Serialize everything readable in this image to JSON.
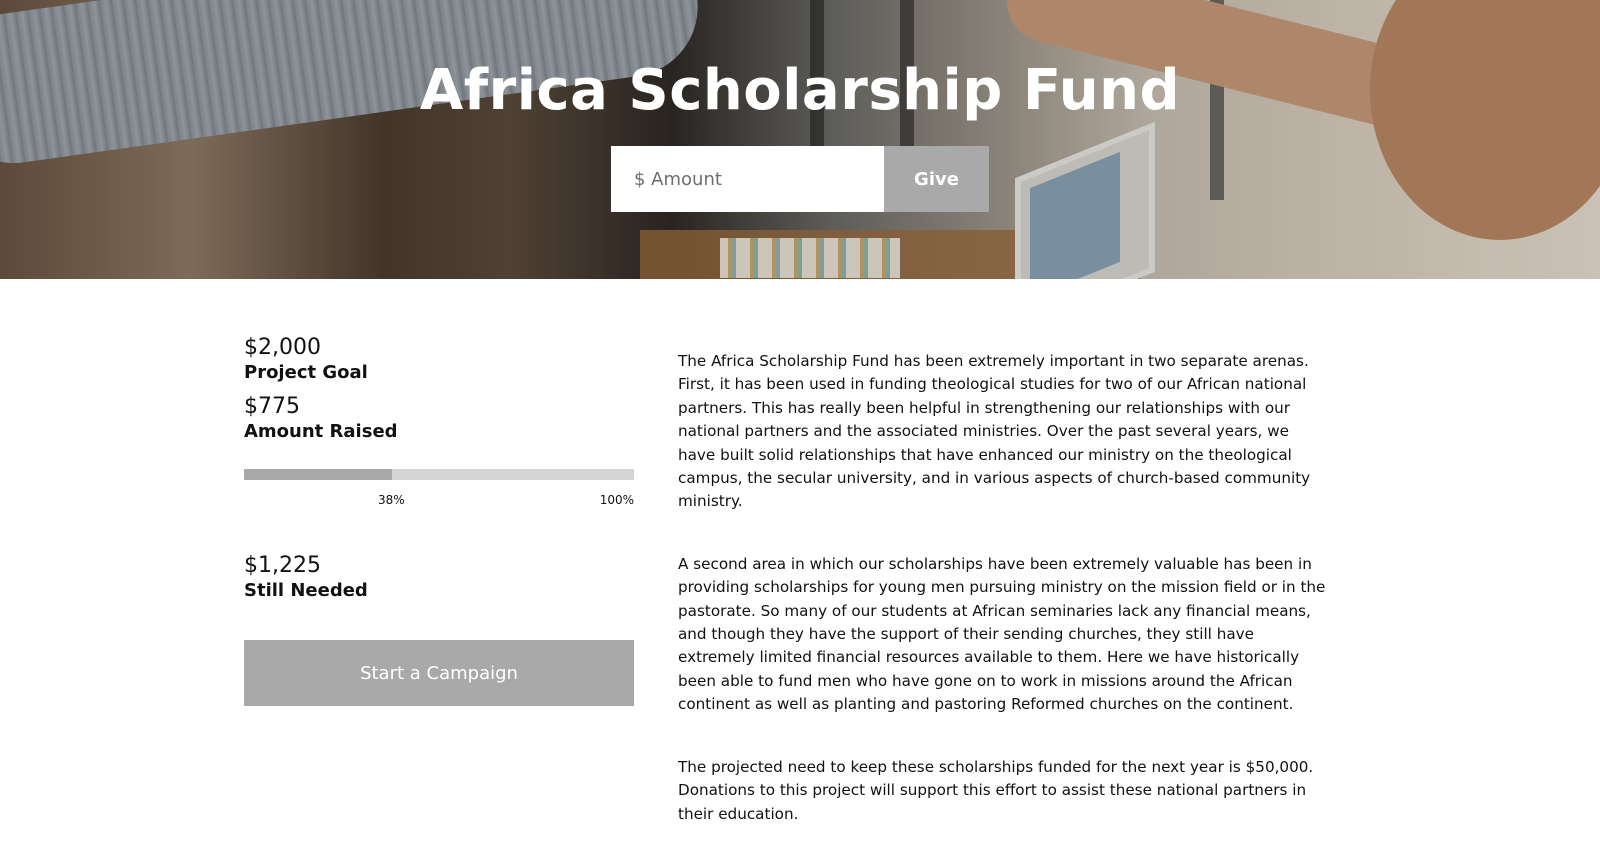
{
  "hero": {
    "title": "Africa Scholarship Fund",
    "amount_placeholder": "$ Amount",
    "give_label": "Give"
  },
  "stats": {
    "goal_value": "$2,000",
    "goal_label": "Project Goal",
    "raised_value": "$775",
    "raised_label": "Amount Raised",
    "progress_fraction": 0.38,
    "progress_current_label": "38%",
    "progress_max_label": "100%",
    "needed_value": "$1,225",
    "needed_label": "Still Needed",
    "campaign_label": "Start a Campaign"
  },
  "description": {
    "paragraphs": [
      "The Africa Scholarship Fund has been extremely important in two separate arenas. First, it has been used in funding theological studies for two of our African national partners. This has really been helpful in strengthening our relationships with our national partners and the associated ministries. Over the past several years, we have built solid relationships that have enhanced our ministry on the theological campus, the secular university, and in various aspects of church-based community ministry.",
      "A second area in which our scholarships have been extremely valuable has been in providing scholarships for young men pursuing ministry on the mission field or in the pastorate. So many of our students at African seminaries lack any financial means, and though they have the support of their sending churches, they still have extremely limited financial resources available to them. Here we have historically been able to fund men who have gone on to work in missions around the African continent as well as planting and pastoring Reformed churches on the continent.",
      "The projected need to keep these scholarships funded for the next year is $50,000. Donations to this project will support this effort to assist these national partners in their education."
    ]
  },
  "colors": {
    "button_gray": "#a9a9a9",
    "track_gray": "#d4d4d4",
    "text": "#111111"
  }
}
